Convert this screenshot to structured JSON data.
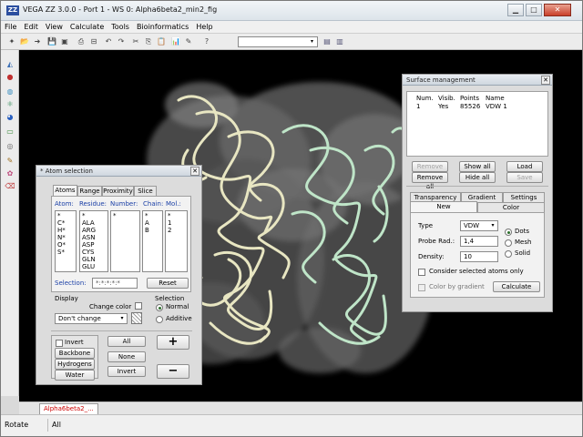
{
  "window": {
    "title": "VEGA ZZ 3.0.0 - Port 1 - WS 0: Alpha6beta2_min2_fig",
    "app_icon": "ZZ",
    "minimize_glyph": "▁",
    "maximize_glyph": "□",
    "close_glyph": "✕"
  },
  "menu": [
    "File",
    "Edit",
    "View",
    "Calculate",
    "Tools",
    "Bioinformatics",
    "Help"
  ],
  "toolbar": {
    "icons": [
      "new-file-icon",
      "open-folder-icon",
      "open-icon",
      "save-icon",
      "save-all-icon",
      "print-icon",
      "print-setup-icon",
      "undo-icon",
      "redo-icon",
      "cut-icon",
      "copy-icon",
      "paste-icon",
      "chart-icon",
      "pencil-icon",
      "help-icon"
    ],
    "glyphs": [
      "✦",
      "📂",
      "➜",
      "💾",
      "▣",
      "⎙",
      "⊟",
      "↶",
      "↷",
      "✂",
      "⎘",
      "📋",
      "📊",
      "✎",
      "?"
    ],
    "dropdown_value": "",
    "dropdown_arrow": "▾",
    "extra_glyphs": [
      "▤",
      "▥"
    ]
  },
  "left_toolbar": {
    "icons": [
      "select-icon",
      "atom-icon",
      "sphere-icon",
      "molecule-icon",
      "globe-icon",
      "display-icon",
      "target-icon",
      "pen-icon",
      "paint-icon",
      "erase-icon"
    ],
    "glyphs": [
      "◭",
      "●",
      "◍",
      "⚛",
      "◕",
      "▭",
      "◎",
      "✎",
      "✿",
      "⌫"
    ],
    "colors": [
      "#3a6fb5",
      "#c03030",
      "#3a8fc0",
      "#2e8b57",
      "#2a60c0",
      "#3a8a3a",
      "#666",
      "#a07020",
      "#c05080",
      "#c04040"
    ]
  },
  "atom_selection": {
    "title": "* Atom selection",
    "close_glyph": "✕",
    "tabs": [
      "Atoms",
      "Range",
      "Proximity",
      "Slice"
    ],
    "columns": [
      "Atom:",
      "Residue:",
      "Number:",
      "Chain:",
      "Mol.:"
    ],
    "atom_list": "*\nC*\nH*\nN*\nO*\nS*",
    "residue_list": "*\nALA\nARG\nASN\nASP\nCYS\nGLN\nGLU",
    "number_list": "*",
    "chain_list": "*\nA\nB",
    "mol_list": "*\n1\n2",
    "selection_label": "Selection:",
    "selection_value": "*:*:*:*:*",
    "reset": "Reset",
    "display_label": "Display",
    "change_color": "Change color",
    "dont_change": "Don't change",
    "combo_arrow": "▾",
    "selection_group": "Selection",
    "normal": "Normal",
    "additive": "Additive",
    "invert_check": "Invert",
    "backbone": "Backbone",
    "hydrogens": "Hydrogens",
    "water": "Water",
    "all": "All",
    "none": "None",
    "invert_btn": "Invert",
    "plus": "+",
    "minus": "−"
  },
  "surface": {
    "title": "Surface management",
    "close_glyph": "✕",
    "headers": [
      "Num.",
      "Visib.",
      "Points",
      "Name"
    ],
    "row": {
      "num": "1",
      "visib": "Yes",
      "points": "85526",
      "name": "VDW 1"
    },
    "remove": "Remove",
    "show_all": "Show all",
    "load": "Load",
    "remove_all": "Remove all",
    "hide_all": "Hide all",
    "save": "Save",
    "tabs_top": [
      "Transparency",
      "Gradient",
      "Settings"
    ],
    "tabs_bottom": [
      "New",
      "Color"
    ],
    "type_label": "Type",
    "type_value": "VDW",
    "probe_label": "Probe Rad.:",
    "probe_value": "1,4",
    "density_label": "Density:",
    "density_value": "10",
    "dots": "Dots",
    "mesh": "Mesh",
    "solid": "Solid",
    "consider": "Consider selected atoms only",
    "color_gradient": "Color by gradient",
    "calculate": "Calculate"
  },
  "doc_tab": "Alpha6beta2_...",
  "status": {
    "left": "Rotate",
    "right": "All"
  }
}
